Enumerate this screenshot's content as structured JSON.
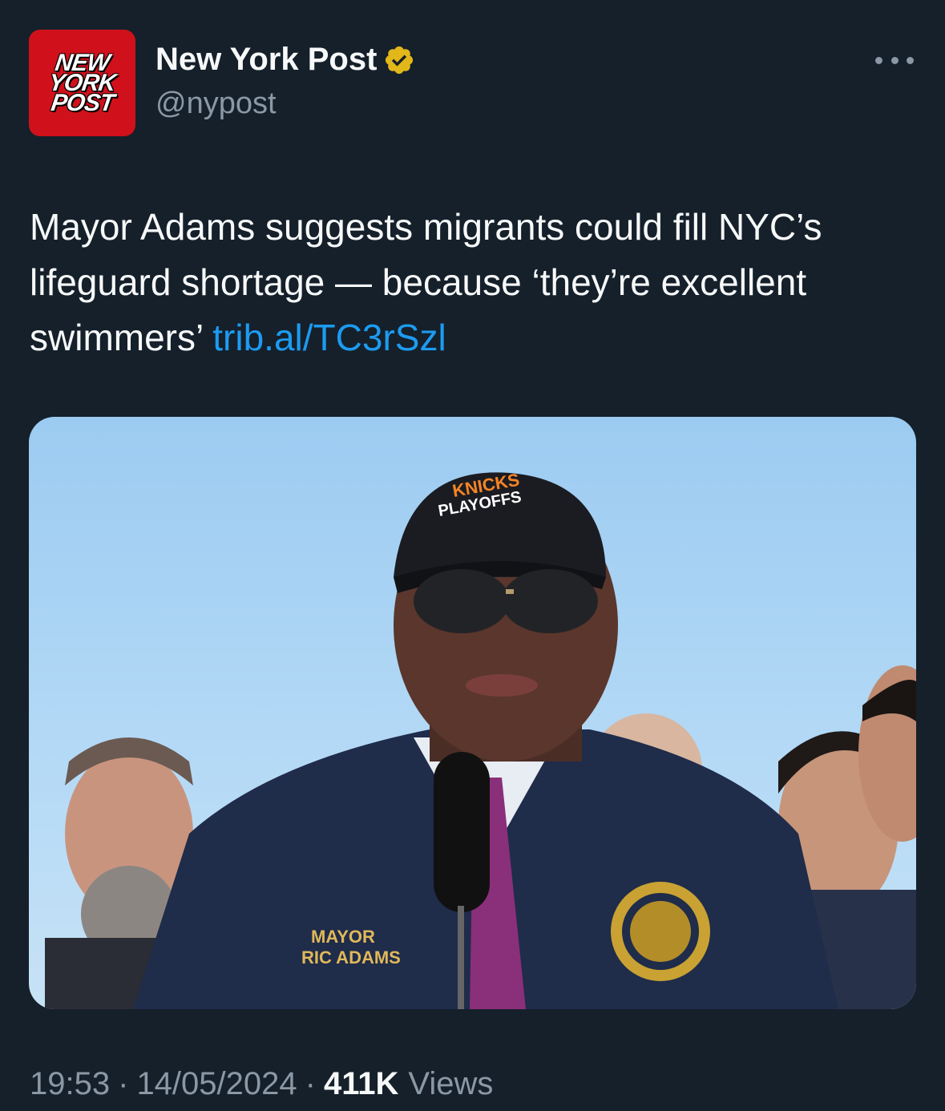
{
  "post": {
    "avatar_logo_lines": [
      "NEW",
      "YORK",
      "POST"
    ],
    "display_name": "New York Post",
    "handle": "@nypost",
    "text_main": "Mayor Adams suggests migrants could fill NYC’s lifeguard shortage — because ‘they’re excellent swimmers’",
    "link": "trib.al/TC3rSzl",
    "media": {
      "cap_lines": [
        "KNICKS",
        "PLAYOFFS"
      ],
      "jacket_lines": [
        "MAYOR",
        "RIC ADAMS"
      ]
    },
    "time": "19:53",
    "date": "14/05/2024",
    "views_count": "411K",
    "views_label": "Views",
    "separator": "·"
  },
  "colors": {
    "background": "#15202b",
    "text": "#f7f9f9",
    "secondary": "#8b98a5",
    "link": "#1d9bf0",
    "verified_badge": "#e2b719",
    "brand": "#d0111b"
  },
  "icons": {
    "verified": "verified-badge-icon",
    "more": "more-options-icon"
  }
}
